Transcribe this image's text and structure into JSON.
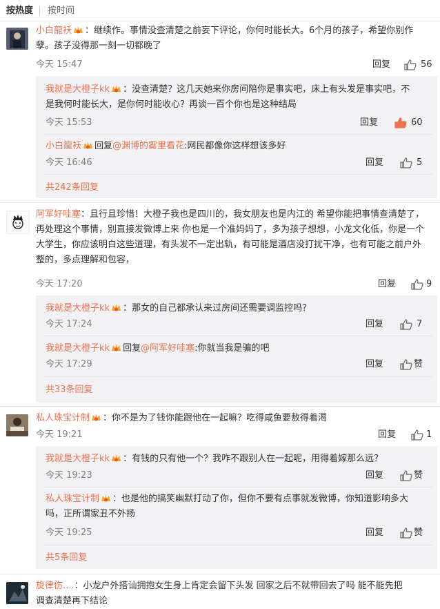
{
  "tabs": {
    "hot": "按热度",
    "time": "按时间"
  },
  "labels": {
    "reply": "回复",
    "zan": "赞",
    "reply_to": "回复"
  },
  "comments": [
    {
      "user": "小白龍袄",
      "text1": "：继续作。事情没查清楚之前妄下评论，你何时能长大。6个月的孩子，希望你别作",
      "text2": "孽。孩子没得那一刻一切都晚了",
      "time": "今天 15:47",
      "likes": "56",
      "subs": [
        {
          "user": "我就是大橙子kk",
          "text1": "：没查清楚？这几天她来你房间陪你是事实吧，床上有头发是事实吧，不",
          "text2": "是我何时能长大，是你何时能收心？再谈一百个你也是这种结局",
          "time": "今天 15:53",
          "likes": "60"
        },
        {
          "user": "小白龍袄",
          "mention": "@渊博的雾里看花",
          "text1": ":网民都像你这样想该多好",
          "time": "今天 16:46",
          "likes": "5"
        }
      ],
      "more": "共242条回复"
    },
    {
      "user": "阿军好哇塞",
      "text1": "：且行且珍惜！大橙子我也是四川的，我女朋友也是内江的 希望你能把事情查清楚了，",
      "text2": "再处理这个事情，别直接发微博上来 你也是一个准妈妈了，多为孩子想想，小龙文化低，你是一个",
      "text3": "大学生，你应该明白这些道理，有头发不一定出轨，有可能是酒店没打扰干净，也有可能之前户外",
      "text4": "整的，多点理解和包容，",
      "time": "今天 17:20",
      "likes": "9",
      "subs": [
        {
          "user": "我就是大橙子kk",
          "text1": "：那女的自己都承认来过房间还需要调监控吗？",
          "time": "今天 17:24",
          "likes": "7"
        },
        {
          "user": "我就是大橙子kk",
          "mention": "@阿军好哇塞",
          "text1": ":你就当我是骗的吧",
          "time": "今天 17:29",
          "likes": "赞"
        }
      ],
      "more": "共33条回复"
    },
    {
      "user": "私人珠宝计制",
      "text1": "：你不是为了钱你能跟他在一起嘛？吃得咸鱼要敖得着渴",
      "time": "今天 19:21",
      "likes": "1",
      "subs": [
        {
          "user": "我就是大橙子kk",
          "text1": "：有钱的只有他一个？我咋不跟别人在一起呢，用得着嫁那么远？",
          "time": "今天 19:23",
          "likes": "赞"
        },
        {
          "user": "私人珠宝计制",
          "text1": "：也是他的搞笑幽默打动了你，但你不要有点事就发微博，你知道影响多大",
          "text2": "吗，正所谓家丑不外扬",
          "time": "今天 19:25",
          "likes": "赞"
        }
      ],
      "more": "共5条回复"
    },
    {
      "user": "旋律伤....",
      "text1": "：小龙户外搭讪拥抱女生身上肯定会留下头发 回家之后不就带回去了吗  能不能先把",
      "text2": "调查清楚再下结论"
    }
  ],
  "colors": {
    "accent": "#eb7350",
    "like_active": "#eb7350",
    "sub_bg": "#f2f2f5",
    "time": "#808080"
  }
}
